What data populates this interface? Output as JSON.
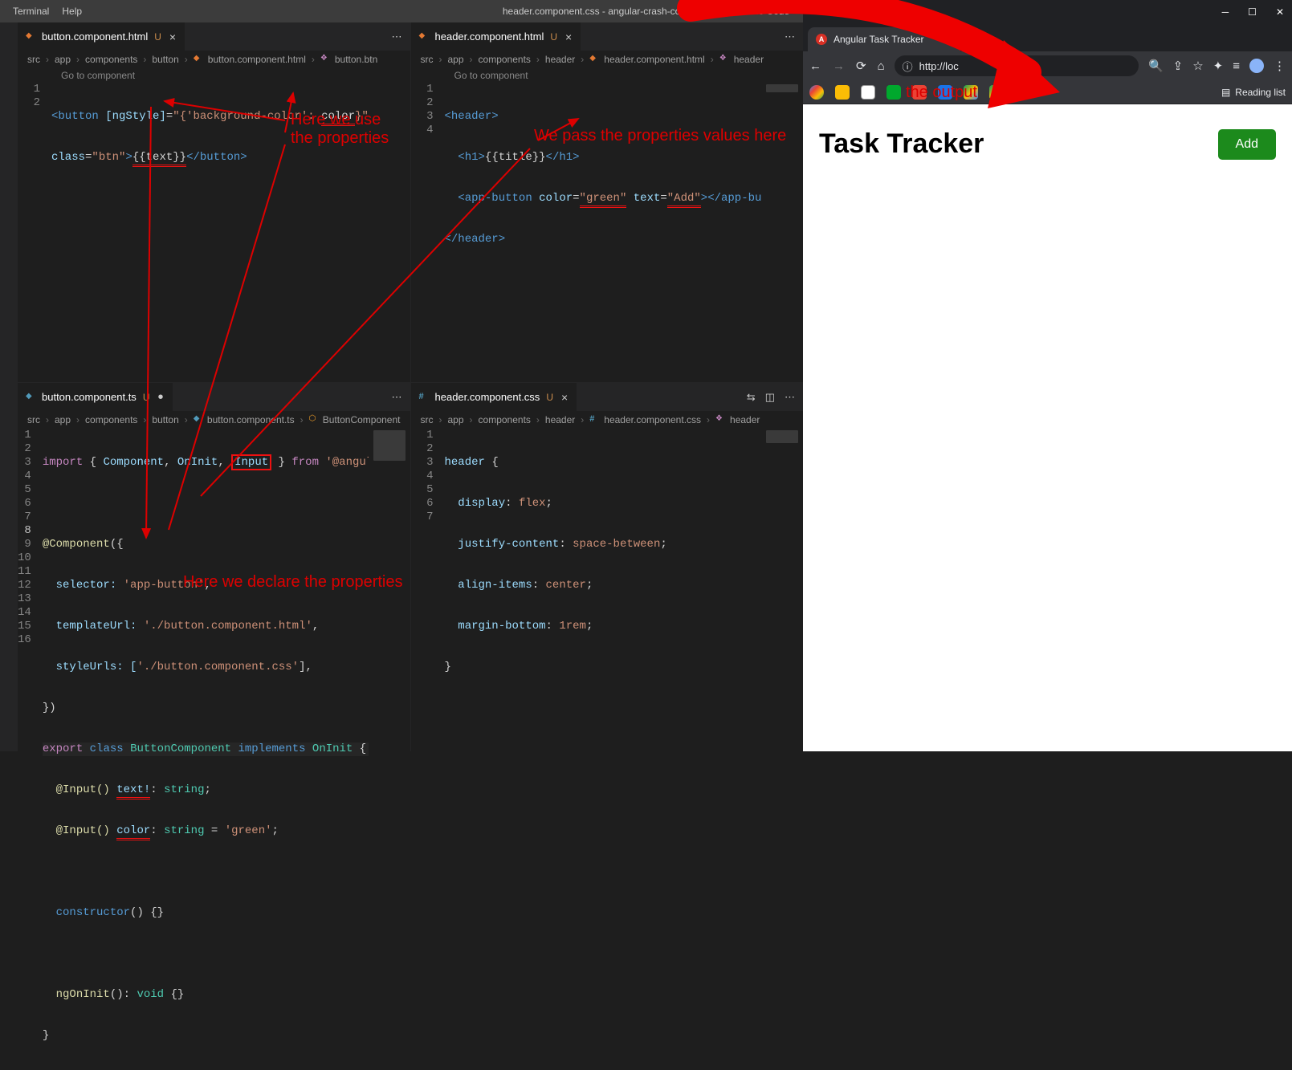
{
  "window": {
    "title": "header.component.css - angular-crash-course - Visual Studio Code",
    "menu": {
      "terminal": "Terminal",
      "help": "Help"
    }
  },
  "panes": {
    "topLeft": {
      "tab": {
        "name": "button.component.html",
        "modified": "U"
      },
      "breadcrumb": [
        "src",
        "app",
        "components",
        "button",
        "button.component.html",
        "button.btn"
      ],
      "codelens": "Go to component",
      "lineNums": [
        "1",
        "2"
      ],
      "code": {
        "l1_a": "<button ",
        "l1_b": "[ngStyle]",
        "l1_c": "=",
        "l1_d": "\"{'background-color': ",
        "l1_e": "color",
        "l1_f": "}\"",
        "l2_a": "class",
        "l2_b": "=",
        "l2_c": "\"btn\"",
        "l2_d": ">",
        "l2_e": "{{text}}",
        "l2_f": "</button>"
      }
    },
    "topRight": {
      "tab": {
        "name": "header.component.html",
        "modified": "U"
      },
      "breadcrumb": [
        "src",
        "app",
        "components",
        "header",
        "header.component.html",
        "header"
      ],
      "codelens": "Go to component",
      "lineNums": [
        "1",
        "2",
        "3",
        "4"
      ],
      "code": {
        "l1": "<header>",
        "l2_a": "  <h1>",
        "l2_b": "{{title}}",
        "l2_c": "</h1>",
        "l3_a": "  <app-button ",
        "l3_b": "color",
        "l3_c": "=",
        "l3_d": "\"green\"",
        "l3_e": " ",
        "l3_f": "text",
        "l3_g": "=",
        "l3_h": "\"Add\"",
        "l3_i": "></app-butt",
        "l4": "</header>"
      }
    },
    "bottomLeft": {
      "tab": {
        "name": "button.component.ts",
        "modified": "U"
      },
      "breadcrumb": [
        "src",
        "app",
        "components",
        "button",
        "button.component.ts",
        "ButtonComponent"
      ],
      "lineNums": [
        "1",
        "2",
        "3",
        "4",
        "5",
        "6",
        "7",
        "8",
        "9",
        "10",
        "11",
        "12",
        "13",
        "14",
        "15",
        "16"
      ],
      "code": {
        "l1_a": "import",
        "l1_b": " { ",
        "l1_c": "Component",
        "l1_d": ", ",
        "l1_e": "OnInit",
        "l1_f": ", ",
        "l1_g": "Input",
        "l1_h": " } ",
        "l1_i": "from",
        "l1_j": " '@angular/core';",
        "l3_a": "@Component",
        "l3_b": "({",
        "l4_a": "  selector: ",
        "l4_b": "'app-button'",
        "l4_c": ",",
        "l5_a": "  templateUrl: ",
        "l5_b": "'./button.component.html'",
        "l5_c": ",",
        "l6_a": "  styleUrls: [",
        "l6_b": "'./button.component.css'",
        "l6_c": "],",
        "l7": "})",
        "l8_a": "export",
        "l8_b": " ",
        "l8_c": "class",
        "l8_d": " ",
        "l8_e": "ButtonComponent",
        "l8_f": " ",
        "l8_g": "implements",
        "l8_h": " ",
        "l8_i": "OnInit",
        "l8_j": " {",
        "l9_a": "  @Input() ",
        "l9_b": "text!",
        "l9_c": ": ",
        "l9_d": "string",
        "l9_e": ";",
        "l10_a": "  @Input() ",
        "l10_b": "color",
        "l10_c": ": ",
        "l10_d": "string",
        "l10_e": " = ",
        "l10_f": "'green'",
        "l10_g": ";",
        "l12_a": "  ",
        "l12_b": "constructor",
        "l12_c": "() {}",
        "l14_a": "  ",
        "l14_b": "ngOnInit",
        "l14_c": "(): ",
        "l14_d": "void",
        "l14_e": " {}",
        "l15": "}"
      }
    },
    "bottomRight": {
      "tab": {
        "name": "header.component.css",
        "modified": "U"
      },
      "breadcrumb": [
        "src",
        "app",
        "components",
        "header",
        "header.component.css",
        "header"
      ],
      "lineNums": [
        "1",
        "2",
        "3",
        "4",
        "5",
        "6",
        "7"
      ],
      "code": {
        "l1_a": "header",
        "l1_b": " {",
        "l2_a": "  display",
        "l2_b": ": ",
        "l2_c": "flex",
        "l2_d": ";",
        "l3_a": "  justify-content",
        "l3_b": ": ",
        "l3_c": "space-between",
        "l3_d": ";",
        "l4_a": "  align-items",
        "l4_b": ": ",
        "l4_c": "center",
        "l4_d": ";",
        "l5_a": "  margin-bottom",
        "l5_b": ": ",
        "l5_c": "1rem",
        "l5_d": ";",
        "l6": "}"
      }
    }
  },
  "browser": {
    "tab_title": "Angular Task Tracker",
    "url": "http://loc",
    "reading_list": "Reading list",
    "page": {
      "title": "Task Tracker",
      "button": "Add"
    }
  },
  "annotations": {
    "output": "the output",
    "use_props": "Here we use\nthe properties",
    "pass_props": "We pass the properties values here",
    "declare_props": "Here we declare the properties"
  }
}
